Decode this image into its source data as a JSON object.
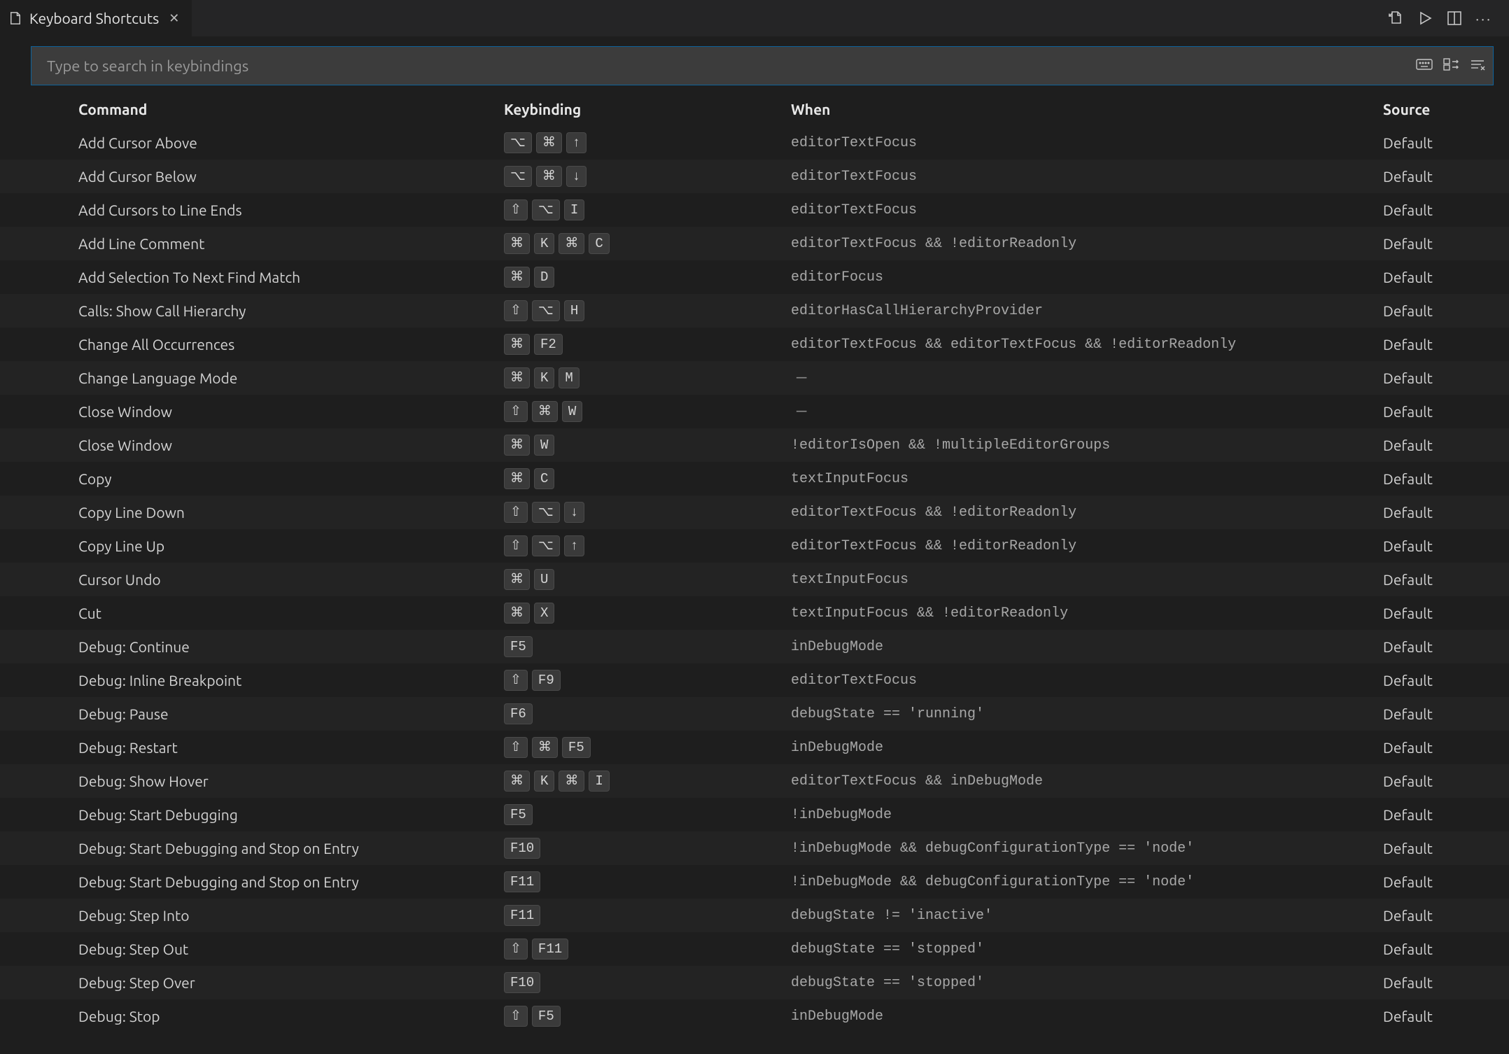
{
  "tab": {
    "title": "Keyboard Shortcuts"
  },
  "search": {
    "placeholder": "Type to search in keybindings"
  },
  "columns": {
    "command": "Command",
    "keybinding": "Keybinding",
    "when": "When",
    "source": "Source"
  },
  "dash": "—",
  "source_default": "Default",
  "rows": [
    {
      "command": "Add Cursor Above",
      "keys": [
        "⌥",
        "⌘",
        "↑"
      ],
      "when": "editorTextFocus",
      "source": "Default"
    },
    {
      "command": "Add Cursor Below",
      "keys": [
        "⌥",
        "⌘",
        "↓"
      ],
      "when": "editorTextFocus",
      "source": "Default"
    },
    {
      "command": "Add Cursors to Line Ends",
      "keys": [
        "⇧",
        "⌥",
        "I"
      ],
      "when": "editorTextFocus",
      "source": "Default"
    },
    {
      "command": "Add Line Comment",
      "keys": [
        "⌘",
        "K",
        "⌘",
        "C"
      ],
      "when": "editorTextFocus && !editorReadonly",
      "source": "Default"
    },
    {
      "command": "Add Selection To Next Find Match",
      "keys": [
        "⌘",
        "D"
      ],
      "when": "editorFocus",
      "source": "Default"
    },
    {
      "command": "Calls: Show Call Hierarchy",
      "keys": [
        "⇧",
        "⌥",
        "H"
      ],
      "when": "editorHasCallHierarchyProvider",
      "source": "Default"
    },
    {
      "command": "Change All Occurrences",
      "keys": [
        "⌘",
        "F2"
      ],
      "when": "editorTextFocus && editorTextFocus && !editorReadonly",
      "source": "Default"
    },
    {
      "command": "Change Language Mode",
      "keys": [
        "⌘",
        "K",
        "M"
      ],
      "when": "—",
      "source": "Default"
    },
    {
      "command": "Close Window",
      "keys": [
        "⇧",
        "⌘",
        "W"
      ],
      "when": "—",
      "source": "Default"
    },
    {
      "command": "Close Window",
      "keys": [
        "⌘",
        "W"
      ],
      "when": "!editorIsOpen && !multipleEditorGroups",
      "source": "Default"
    },
    {
      "command": "Copy",
      "keys": [
        "⌘",
        "C"
      ],
      "when": "textInputFocus",
      "source": "Default"
    },
    {
      "command": "Copy Line Down",
      "keys": [
        "⇧",
        "⌥",
        "↓"
      ],
      "when": "editorTextFocus && !editorReadonly",
      "source": "Default"
    },
    {
      "command": "Copy Line Up",
      "keys": [
        "⇧",
        "⌥",
        "↑"
      ],
      "when": "editorTextFocus && !editorReadonly",
      "source": "Default"
    },
    {
      "command": "Cursor Undo",
      "keys": [
        "⌘",
        "U"
      ],
      "when": "textInputFocus",
      "source": "Default"
    },
    {
      "command": "Cut",
      "keys": [
        "⌘",
        "X"
      ],
      "when": "textInputFocus && !editorReadonly",
      "source": "Default"
    },
    {
      "command": "Debug: Continue",
      "keys": [
        "F5"
      ],
      "when": "inDebugMode",
      "source": "Default"
    },
    {
      "command": "Debug: Inline Breakpoint",
      "keys": [
        "⇧",
        "F9"
      ],
      "when": "editorTextFocus",
      "source": "Default"
    },
    {
      "command": "Debug: Pause",
      "keys": [
        "F6"
      ],
      "when": "debugState == 'running'",
      "source": "Default"
    },
    {
      "command": "Debug: Restart",
      "keys": [
        "⇧",
        "⌘",
        "F5"
      ],
      "when": "inDebugMode",
      "source": "Default"
    },
    {
      "command": "Debug: Show Hover",
      "keys": [
        "⌘",
        "K",
        "⌘",
        "I"
      ],
      "when": "editorTextFocus && inDebugMode",
      "source": "Default"
    },
    {
      "command": "Debug: Start Debugging",
      "keys": [
        "F5"
      ],
      "when": "!inDebugMode",
      "source": "Default"
    },
    {
      "command": "Debug: Start Debugging and Stop on Entry",
      "keys": [
        "F10"
      ],
      "when": "!inDebugMode && debugConfigurationType == 'node'",
      "source": "Default"
    },
    {
      "command": "Debug: Start Debugging and Stop on Entry",
      "keys": [
        "F11"
      ],
      "when": "!inDebugMode && debugConfigurationType == 'node'",
      "source": "Default"
    },
    {
      "command": "Debug: Step Into",
      "keys": [
        "F11"
      ],
      "when": "debugState != 'inactive'",
      "source": "Default"
    },
    {
      "command": "Debug: Step Out",
      "keys": [
        "⇧",
        "F11"
      ],
      "when": "debugState == 'stopped'",
      "source": "Default"
    },
    {
      "command": "Debug: Step Over",
      "keys": [
        "F10"
      ],
      "when": "debugState == 'stopped'",
      "source": "Default"
    },
    {
      "command": "Debug: Stop",
      "keys": [
        "⇧",
        "F5"
      ],
      "when": "inDebugMode",
      "source": "Default"
    }
  ]
}
